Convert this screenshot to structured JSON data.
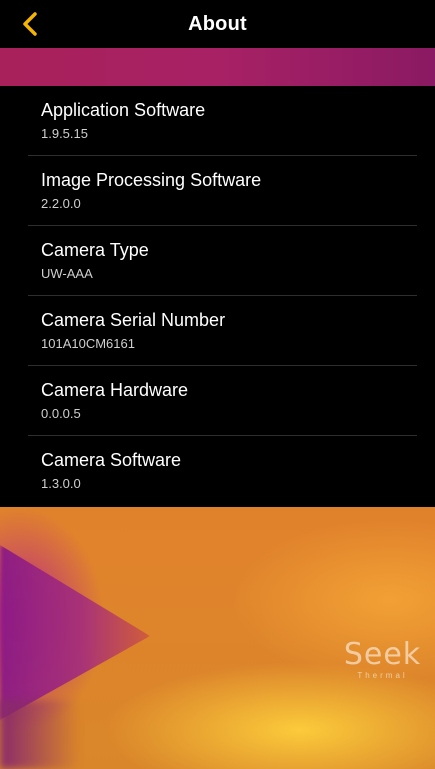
{
  "header": {
    "title": "About"
  },
  "items": [
    {
      "label": "Application Software",
      "value": "1.9.5.15"
    },
    {
      "label": "Image Processing Software",
      "value": "2.2.0.0"
    },
    {
      "label": "Camera Type",
      "value": "UW-AAA"
    },
    {
      "label": "Camera Serial Number",
      "value": "101A10CM6161"
    },
    {
      "label": "Camera Hardware",
      "value": "0.0.0.5"
    },
    {
      "label": "Camera Software",
      "value": "1.3.0.0"
    }
  ],
  "logo": {
    "main": "Seek",
    "sub": "Thermal"
  },
  "colors": {
    "accent": "#f5b400",
    "strip": "#a8215a",
    "background": "#000000"
  },
  "icons": {
    "back": "chevron-left-icon"
  }
}
